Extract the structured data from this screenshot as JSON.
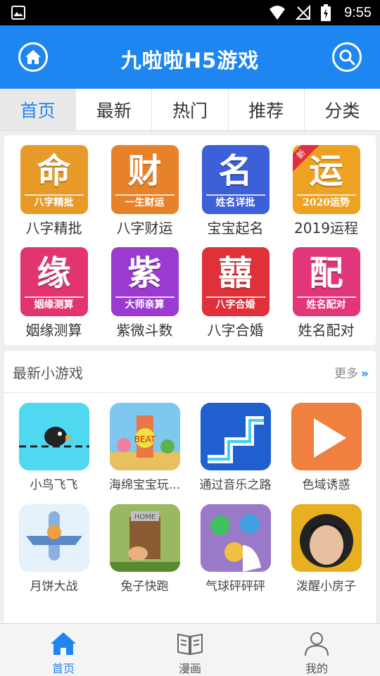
{
  "status_bar": {
    "time": "9:55"
  },
  "header": {
    "title": "九啦啦H5游戏"
  },
  "tabs": [
    {
      "label": "首页",
      "active": true
    },
    {
      "label": "最新",
      "active": false
    },
    {
      "label": "热门",
      "active": false
    },
    {
      "label": "推荐",
      "active": false
    },
    {
      "label": "分类",
      "active": false
    }
  ],
  "fortune": [
    {
      "char": "命",
      "band": "八字精批",
      "label": "八字精批",
      "color": "#e79a28"
    },
    {
      "char": "财",
      "band": "一生财运",
      "label": "八字财运",
      "color": "#e8822a"
    },
    {
      "char": "名",
      "band": "姓名详批",
      "label": "宝宝起名",
      "color": "#3d5fd8"
    },
    {
      "char": "运",
      "band": "2020运势",
      "label": "2019运程",
      "color": "#eda221",
      "badge": "新"
    },
    {
      "char": "缘",
      "band": "姻缘测算",
      "label": "姻缘测算",
      "color": "#e2356f"
    },
    {
      "char": "紫",
      "band": "大师亲算",
      "label": "紫微斗数",
      "color": "#9b3ad0"
    },
    {
      "char": "囍",
      "band": "八字合婚",
      "label": "八字合婚",
      "color": "#e0303a"
    },
    {
      "char": "配",
      "band": "姓名配对",
      "label": "姓名配对",
      "color": "#e2357a"
    }
  ],
  "games_section": {
    "title": "最新小游戏",
    "more": "更多"
  },
  "games": [
    {
      "label": "小鸟飞飞",
      "icon": "bird-game-icon",
      "color": "#4fd8f0"
    },
    {
      "label": "海绵宝宝玩...",
      "icon": "spongebob-game-icon",
      "color": "#f0c040"
    },
    {
      "label": "通过音乐之路",
      "icon": "music-road-game-icon",
      "color": "#1f5fd0"
    },
    {
      "label": "色域诱惑",
      "icon": "play-game-icon",
      "color": "#f08040"
    },
    {
      "label": "月饼大战",
      "icon": "plane-game-icon",
      "color": "#e6f2fb"
    },
    {
      "label": "兔子快跑",
      "icon": "rabbit-game-icon",
      "color": "#7a9a3a"
    },
    {
      "label": "气球砰砰砰",
      "icon": "balloon-game-icon",
      "color": "#9a7ac8"
    },
    {
      "label": "泼醒小房子",
      "icon": "face-game-icon",
      "color": "#e8b020"
    }
  ],
  "bottom_nav": [
    {
      "label": "首页",
      "icon": "home-icon",
      "active": true
    },
    {
      "label": "漫画",
      "icon": "book-icon",
      "active": false
    },
    {
      "label": "我的",
      "icon": "user-icon",
      "active": false
    }
  ]
}
